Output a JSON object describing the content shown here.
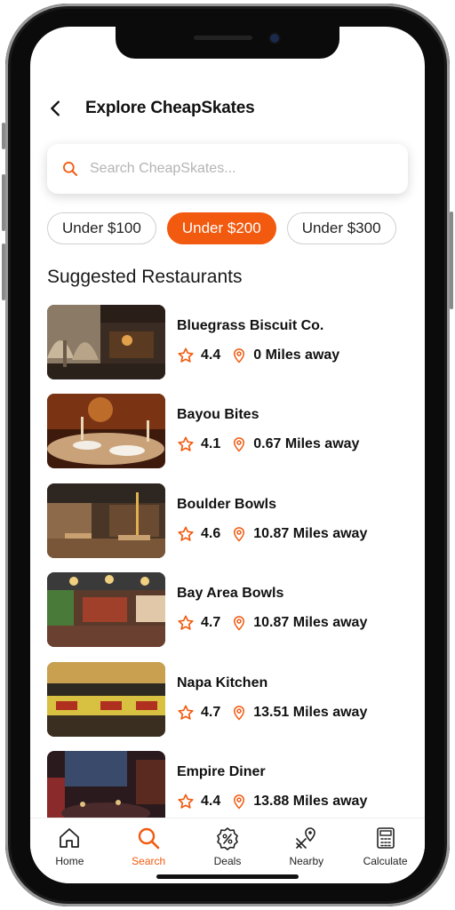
{
  "header": {
    "title": "Explore CheapSkates",
    "back_icon": "chevron-left-icon"
  },
  "search": {
    "placeholder": "Search CheapSkates...",
    "value": "",
    "icon": "search-icon"
  },
  "filters": [
    {
      "label": "Under $100",
      "active": false
    },
    {
      "label": "Under $200",
      "active": true
    },
    {
      "label": "Under $300",
      "active": false
    }
  ],
  "section_title": "Suggested Restaurants",
  "restaurants": [
    {
      "name": "Bluegrass Biscuit Co.",
      "rating": "4.4",
      "distance": "0 Miles away"
    },
    {
      "name": "Bayou Bites",
      "rating": "4.1",
      "distance": "0.67 Miles away"
    },
    {
      "name": "Boulder Bowls",
      "rating": "4.6",
      "distance": "10.87 Miles away"
    },
    {
      "name": "Bay Area Bowls",
      "rating": "4.7",
      "distance": "10.87 Miles away"
    },
    {
      "name": "Napa Kitchen",
      "rating": "4.7",
      "distance": "13.51 Miles away"
    },
    {
      "name": "Empire Diner",
      "rating": "4.4",
      "distance": "13.88 Miles away"
    }
  ],
  "tabs": [
    {
      "label": "Home",
      "icon": "home-icon",
      "active": false
    },
    {
      "label": "Search",
      "icon": "search-icon",
      "active": true
    },
    {
      "label": "Deals",
      "icon": "percent-badge-icon",
      "active": false
    },
    {
      "label": "Nearby",
      "icon": "map-pin-icon",
      "active": false
    },
    {
      "label": "Calculate",
      "icon": "calculator-icon",
      "active": false
    }
  ],
  "colors": {
    "accent": "#f25a0f",
    "text": "#111111",
    "muted": "#b4b4b4",
    "chip_border": "#cfcfcf"
  }
}
